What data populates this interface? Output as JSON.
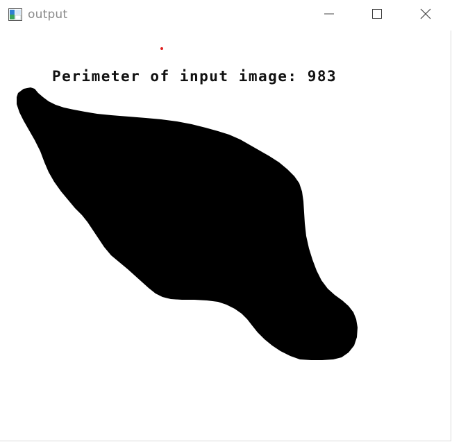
{
  "window": {
    "title": "output",
    "icon": "app-window-icon",
    "controls": {
      "minimize_icon": "minimize-icon",
      "maximize_icon": "maximize-icon",
      "close_icon": "close-icon"
    }
  },
  "canvas": {
    "label": "Perimeter of input image: 983",
    "shape_color": "#000000",
    "background_color": "#ffffff",
    "marker_color": "#e02020"
  },
  "colors": {
    "title_text": "#8a8a8a",
    "control_glyph": "#444444"
  }
}
